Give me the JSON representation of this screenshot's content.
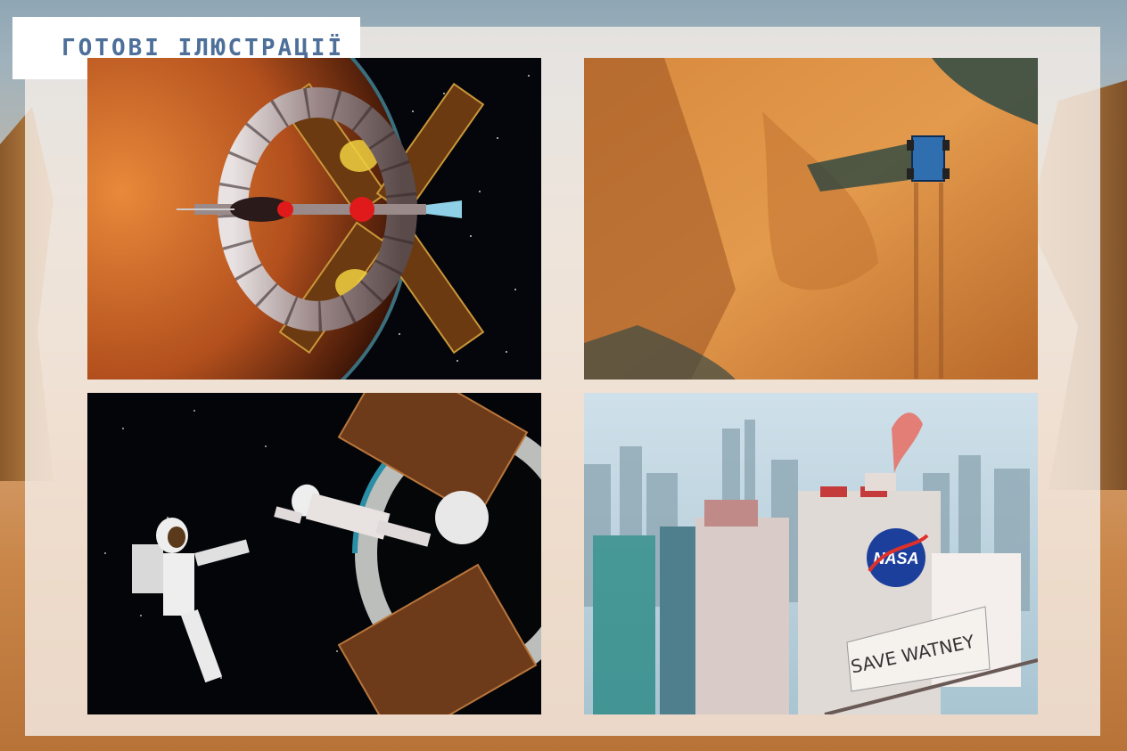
{
  "header": {
    "title": "ГОТОВІ ІЛЮСТРАЦІЇ"
  },
  "illustrations": [
    {
      "name": "Space station orbiting Mars",
      "icon": "space-station-image"
    },
    {
      "name": "Rover on Martian terrain",
      "icon": "mars-rover-image"
    },
    {
      "name": "Astronauts spacewalk",
      "icon": "astronauts-image"
    },
    {
      "name": "City with NASA building",
      "icon": "nasa-city-image",
      "sign_text": "NASA",
      "banner_text": "SAVE WATNEY"
    }
  ],
  "colors": {
    "title": "#4d6f99",
    "panel": "#f5eee8",
    "mars": "#c9762e"
  }
}
